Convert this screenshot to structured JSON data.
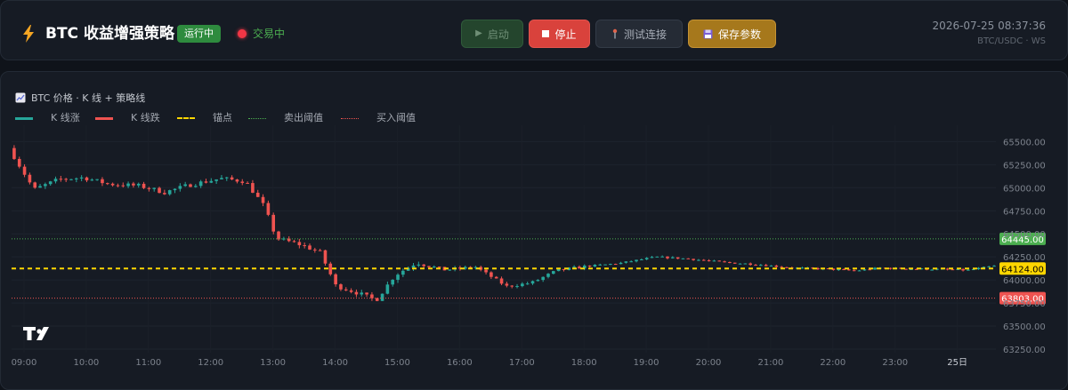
{
  "header": {
    "title": "BTC 收益增强策略",
    "run_badge": "运行中",
    "trade_status": "交易中",
    "datetime": "2026-07-25 08:37:36",
    "pair": "BTC/USDC · WS",
    "buttons": {
      "start": "启动",
      "stop": "停止",
      "test": "测试连接",
      "save": "保存参数"
    }
  },
  "panel": {
    "title": "BTC 价格 · K 线 + 策略线",
    "legend": {
      "up": "K 线涨",
      "down": "K 线跌",
      "anchor": "锚点",
      "sell": "卖出阈值",
      "buy": "买入阈值"
    }
  },
  "colors": {
    "up": "#26a69a",
    "down": "#ef5350",
    "anchor": "#ffd600",
    "sell": "#4caf50",
    "buy": "#ef5350",
    "start_btn": "#24452d",
    "stop_btn": "#d9423c",
    "save_btn": "#a6781c"
  },
  "icons": {
    "title": "lightning-bolt-icon",
    "start": "play-icon",
    "stop": "stop-square-icon",
    "test": "antenna-icon",
    "save": "floppy-disk-icon",
    "chart": "chart-icon",
    "watermark": "tradingview-logo"
  },
  "chart_data": {
    "type": "candlestick",
    "y_ticks": [
      65500,
      65250,
      65000,
      64750,
      64500,
      64250,
      64000,
      63750,
      63500,
      63250
    ],
    "y_tick_labels": [
      "65500.00",
      "65250.00",
      "65000.00",
      "64750.00",
      "64500.00",
      "64250.00",
      "64000.00",
      "63750.00",
      "63500.00",
      "63250.00"
    ],
    "ylim": [
      63250,
      65600
    ],
    "x_tick_labels": [
      "09:00",
      "10:00",
      "11:00",
      "12:00",
      "13:00",
      "14:00",
      "15:00",
      "16:00",
      "17:00",
      "18:00",
      "19:00",
      "20:00",
      "21:00",
      "22:00",
      "23:00",
      "25日"
    ],
    "x_start_hour": 8.8,
    "x_end_hour": 24.62,
    "candle_minutes": 5,
    "sell_threshold": 64445,
    "anchor": 64124,
    "buy_threshold": 63803,
    "sell_label": "64445.00",
    "anchor_label": "64124.00",
    "buy_label": "63803.00",
    "path": [
      [
        8.8,
        65430
      ],
      [
        9.2,
        64980
      ],
      [
        9.6,
        65090
      ],
      [
        10.0,
        65110
      ],
      [
        10.4,
        65040
      ],
      [
        10.9,
        65020
      ],
      [
        11.3,
        64950
      ],
      [
        11.7,
        65030
      ],
      [
        12.2,
        65100
      ],
      [
        12.6,
        65070
      ],
      [
        12.9,
        64800
      ],
      [
        13.1,
        64450
      ],
      [
        13.5,
        64380
      ],
      [
        13.8,
        64300
      ],
      [
        14.05,
        63940
      ],
      [
        14.4,
        63860
      ],
      [
        14.7,
        63780
      ],
      [
        15.0,
        64050
      ],
      [
        15.35,
        64190
      ],
      [
        15.8,
        64110
      ],
      [
        16.3,
        64140
      ],
      [
        16.8,
        63930
      ],
      [
        17.2,
        63970
      ],
      [
        17.6,
        64100
      ],
      [
        18.1,
        64150
      ],
      [
        18.6,
        64180
      ],
      [
        19.2,
        64250
      ],
      [
        19.7,
        64230
      ],
      [
        20.3,
        64190
      ],
      [
        20.8,
        64170
      ],
      [
        21.4,
        64130
      ],
      [
        21.9,
        64120
      ],
      [
        22.4,
        64100
      ],
      [
        22.8,
        64130
      ],
      [
        23.3,
        64120
      ],
      [
        23.8,
        64115
      ],
      [
        24.2,
        64105
      ],
      [
        24.62,
        64150
      ]
    ]
  }
}
